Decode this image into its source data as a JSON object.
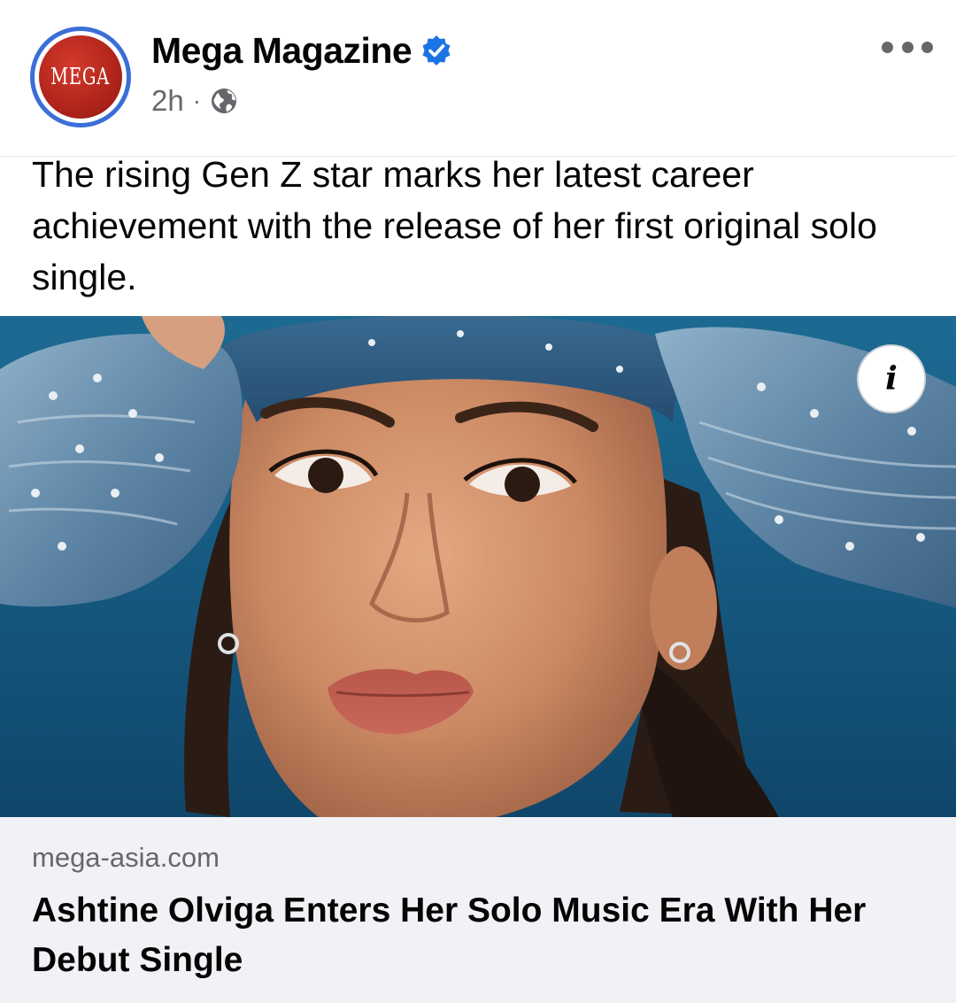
{
  "post": {
    "page_name": "Mega Magazine",
    "avatar_text": "MEGA",
    "timestamp": "2h",
    "separator": "·",
    "privacy_icon": "globe-icon",
    "verified_icon": "verified-badge-icon",
    "more_icon": "more-options-icon",
    "caption": "The rising Gen Z star marks her latest career achievement with the release of her first original solo single."
  },
  "link_preview": {
    "info_icon": "info-icon",
    "info_label": "i",
    "domain": "mega-asia.com",
    "headline": "Ashtine Olviga Enters Her Solo Music Era With Her Debut Single"
  },
  "colors": {
    "verified_blue": "#1b74e4",
    "avatar_ring": "#3b6fd8",
    "avatar_red": "#b0241b",
    "secondary_text": "#65676b",
    "card_bg": "#f0f2f5"
  }
}
